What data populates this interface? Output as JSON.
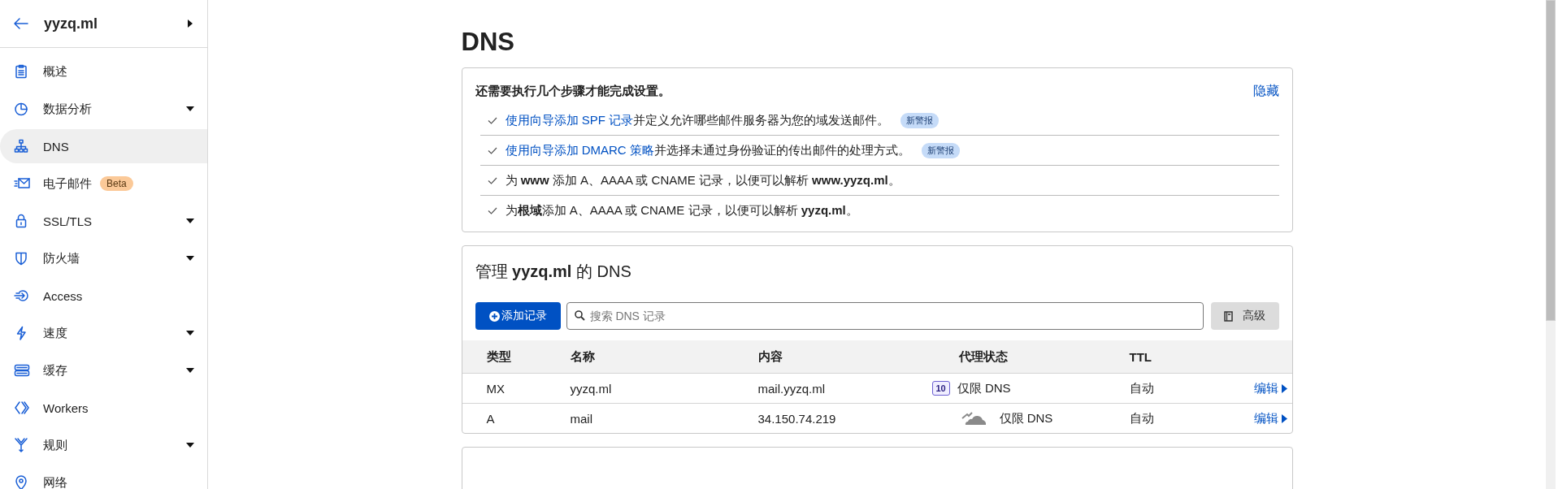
{
  "sidebar": {
    "domain": "yyzq.ml",
    "items": [
      {
        "label": "概述",
        "expandable": false,
        "selected": false
      },
      {
        "label": "数据分析",
        "expandable": true,
        "selected": false
      },
      {
        "label": "DNS",
        "expandable": false,
        "selected": true
      },
      {
        "label": "电子邮件",
        "expandable": false,
        "selected": false,
        "badge": "Beta"
      },
      {
        "label": "SSL/TLS",
        "expandable": true,
        "selected": false
      },
      {
        "label": "防火墙",
        "expandable": true,
        "selected": false
      },
      {
        "label": "Access",
        "expandable": false,
        "selected": false
      },
      {
        "label": "速度",
        "expandable": true,
        "selected": false
      },
      {
        "label": "缓存",
        "expandable": true,
        "selected": false
      },
      {
        "label": "Workers",
        "expandable": false,
        "selected": false
      },
      {
        "label": "规则",
        "expandable": true,
        "selected": false
      },
      {
        "label": "网络",
        "expandable": false,
        "selected": false
      }
    ]
  },
  "page_title": "DNS",
  "setup": {
    "heading": "还需要执行几个步骤才能完成设置。",
    "hide_link": "隐藏",
    "steps": [
      {
        "link": "使用向导添加 SPF 记录",
        "text": "并定义允许哪些邮件服务器为您的域发送邮件。",
        "badge": "新警报"
      },
      {
        "link": "使用向导添加 DMARC 策略",
        "text": "并选择未通过身份验证的传出邮件的处理方式。",
        "badge": "新警报"
      },
      {
        "text": "为 **www** 添加 A、AAAA 或 CNAME 记录，以便可以解析 **www.yyzq.ml**。"
      },
      {
        "text": "为**根域**添加 A、AAAA 或 CNAME 记录，以便可以解析 **yyzq.ml**。"
      }
    ]
  },
  "dns": {
    "title": "管理 **yyzq.ml** 的 DNS",
    "add_button": "添加记录",
    "search": {
      "placeholder": "搜索 DNS 记录"
    },
    "advanced_button": "高级",
    "columns": [
      "类型",
      "名称",
      "内容",
      "代理状态",
      "TTL"
    ],
    "rows": [
      {
        "type": "MX",
        "name": "yyzq.ml",
        "content": "mail.yyzq.ml",
        "priority": "10",
        "proxy_status": "仅限 DNS",
        "ttl": "自动",
        "edit": "编辑"
      },
      {
        "type": "A",
        "name": "mail",
        "content": "34.150.74.219",
        "proxied": false,
        "proxy_status": "仅限 DNS",
        "ttl": "自动",
        "edit": "编辑"
      }
    ]
  }
}
